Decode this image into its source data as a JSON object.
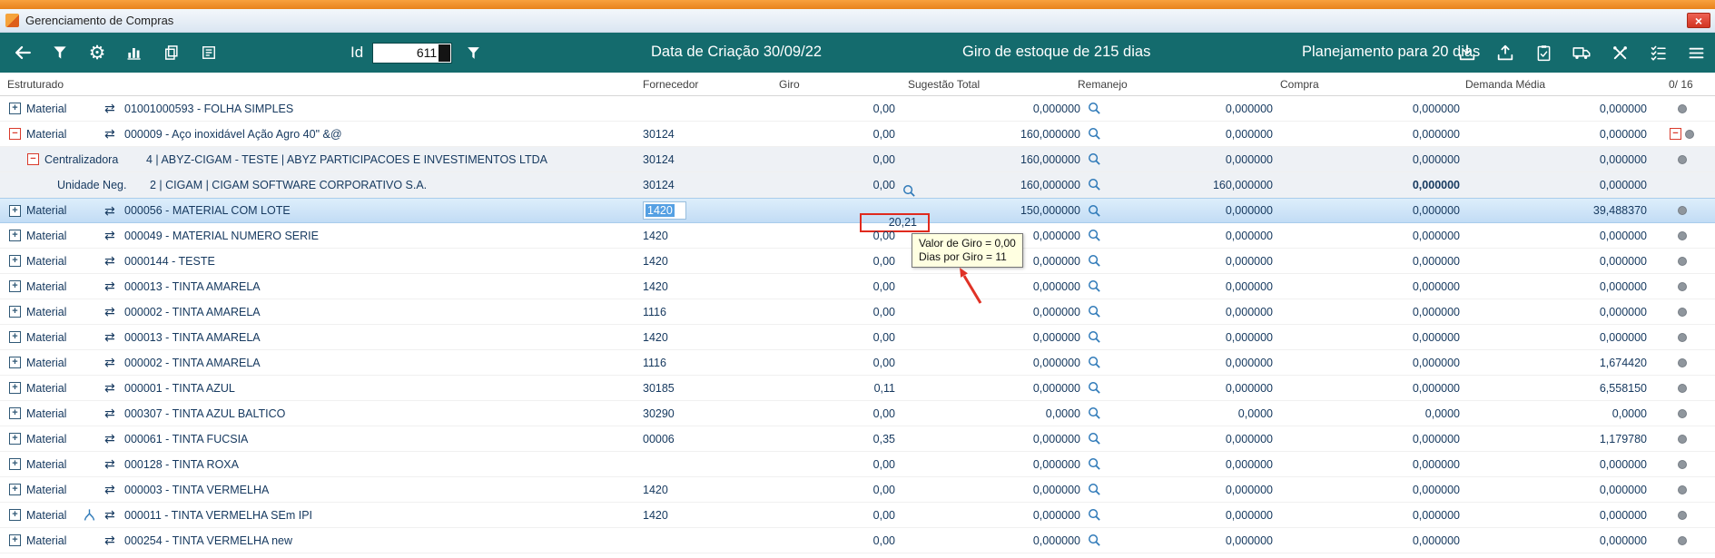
{
  "window": {
    "title": "Gerenciamento de Compras",
    "close_glyph": "×"
  },
  "toolbar": {
    "id_label": "Id",
    "id_value": "611",
    "data_criacao": "Data de Criação 30/09/22",
    "giro_estoque": "Giro de estoque de  215 dias",
    "planejamento": "Planejamento para 20 dias",
    "left_icons": [
      "back-arrow",
      "filter-funnel",
      "settings-gear",
      "bar-chart",
      "copy-pages",
      "notes-card"
    ],
    "right_icons": [
      "import-tray",
      "export-tray",
      "clipboard-check",
      "delivery-truck",
      "tools-cross",
      "task-checklist",
      "hamburger-menu"
    ]
  },
  "colors": {
    "toolbar_teal": "#146b6d",
    "top_strip_orange": "#ee8a24",
    "selected_row_blue": "#c6def5",
    "annotation_red": "#e02a1e",
    "tooltip_yellow": "#ffffe1",
    "row_text_navy": "#173a60"
  },
  "columns": [
    "Estruturado",
    "Fornecedor",
    "Giro",
    "Sugestão Total",
    "Remanejo",
    "Compra",
    "Demanda Média",
    "0/ 16"
  ],
  "tooltip": {
    "line1": "Valor de Giro = 0,00",
    "line2": "Dias por Giro = 11"
  },
  "rows": [
    {
      "level": 0,
      "expand": "plus",
      "type": "Material",
      "swap": true,
      "label": "01001000593 -  FOLHA SIMPLES",
      "fornecedor": "",
      "giro": "0,00",
      "sugestao": "0,000000",
      "remanejo": "0,000000",
      "compra": "0,000000",
      "demanda": "0,000000",
      "dot": true,
      "bg": "white"
    },
    {
      "level": 0,
      "expand": "minus",
      "type": "Material",
      "swap": true,
      "label": "000009 - Aço inoxidável Ação Agro 40\" &@",
      "fornecedor": "30124",
      "giro": "0,00",
      "sugestao": "160,000000",
      "remanejo": "0,000000",
      "compra": "0,000000",
      "demanda": "0,000000",
      "dot": true,
      "red_minus_right": true,
      "bg": "white"
    },
    {
      "level": 1,
      "expand": "minus",
      "type": "Centralizadora",
      "swap": false,
      "label": "4  | ABYZ-CIGAM - TESTE | ABYZ PARTICIPACOES E INVESTIMENTOS LTDA",
      "fornecedor": "30124",
      "giro": "0,00",
      "sugestao": "160,000000",
      "remanejo": "0,000000",
      "compra": "0,000000",
      "demanda": "0,000000",
      "dot": true,
      "bg": "shade"
    },
    {
      "level": 2,
      "expand": "none",
      "type": "Unidade Neg.",
      "swap": false,
      "label": "2 | CIGAM | CIGAM SOFTWARE CORPORATIVO S.A.",
      "fornecedor": "30124",
      "giro": "0,00",
      "giro_mag": true,
      "sugestao": "160,000000",
      "remanejo": "160,000000",
      "compra": "0,000000",
      "compra_bold": true,
      "demanda": "0,000000",
      "dot": false,
      "bg": "shade"
    },
    {
      "level": 0,
      "expand": "plus",
      "type": "Material",
      "swap": true,
      "label": "000056 - MATERIAL  COM LOTE",
      "fornecedor": "1420",
      "forn_sel": true,
      "giro": "20,21",
      "giro_box": true,
      "sugestao": "150,000000",
      "remanejo": "0,000000",
      "compra": "0,000000",
      "demanda": "39,488370",
      "dot": true,
      "bg": "selected"
    },
    {
      "level": 0,
      "expand": "plus",
      "type": "Material",
      "swap": true,
      "label": "000049 - MATERIAL NUMERO SERIE",
      "fornecedor": "1420",
      "giro": "0,00",
      "sugestao": "0,000000",
      "remanejo": "0,000000",
      "compra": "0,000000",
      "demanda": "0,000000",
      "dot": true,
      "bg": "white"
    },
    {
      "level": 0,
      "expand": "plus",
      "type": "Material",
      "swap": true,
      "label": "0000144 - TESTE",
      "fornecedor": "1420",
      "giro": "0,00",
      "sugestao": "0,000000",
      "remanejo": "0,000000",
      "compra": "0,000000",
      "demanda": "0,000000",
      "dot": true,
      "bg": "white"
    },
    {
      "level": 0,
      "expand": "plus",
      "type": "Material",
      "swap": true,
      "label": "000013 - TINTA AMARELA",
      "fornecedor": "1420",
      "giro": "0,00",
      "sugestao": "0,000000",
      "remanejo": "0,000000",
      "compra": "0,000000",
      "demanda": "0,000000",
      "dot": true,
      "bg": "white"
    },
    {
      "level": 0,
      "expand": "plus",
      "type": "Material",
      "swap": true,
      "label": "000002 - TINTA AMARELA",
      "fornecedor": "1116",
      "giro": "0,00",
      "sugestao": "0,000000",
      "remanejo": "0,000000",
      "compra": "0,000000",
      "demanda": "0,000000",
      "dot": true,
      "bg": "white"
    },
    {
      "level": 0,
      "expand": "plus",
      "type": "Material",
      "swap": true,
      "label": "000013 - TINTA AMARELA",
      "fornecedor": "1420",
      "giro": "0,00",
      "sugestao": "0,000000",
      "remanejo": "0,000000",
      "compra": "0,000000",
      "demanda": "0,000000",
      "dot": true,
      "bg": "white"
    },
    {
      "level": 0,
      "expand": "plus",
      "type": "Material",
      "swap": true,
      "label": "000002 - TINTA AMARELA",
      "fornecedor": "1116",
      "giro": "0,00",
      "sugestao": "0,000000",
      "remanejo": "0,000000",
      "compra": "0,000000",
      "demanda": "1,674420",
      "dot": true,
      "bg": "white"
    },
    {
      "level": 0,
      "expand": "plus",
      "type": "Material",
      "swap": true,
      "label": "000001 - TINTA AZUL",
      "fornecedor": "30185",
      "giro": "0,11",
      "sugestao": "0,000000",
      "remanejo": "0,000000",
      "compra": "0,000000",
      "demanda": "6,558150",
      "dot": true,
      "bg": "white"
    },
    {
      "level": 0,
      "expand": "plus",
      "type": "Material",
      "swap": true,
      "label": "000307 - TINTA AZUL BALTICO",
      "fornecedor": "30290",
      "giro": "0,00",
      "sugestao": "0,0000",
      "remanejo": "0,0000",
      "compra": "0,0000",
      "demanda": "0,0000",
      "dot": true,
      "bg": "white"
    },
    {
      "level": 0,
      "expand": "plus",
      "type": "Material",
      "swap": true,
      "label": "000061 - TINTA FUCSIA",
      "fornecedor": "00006",
      "giro": "0,35",
      "sugestao": "0,000000",
      "remanejo": "0,000000",
      "compra": "0,000000",
      "demanda": "1,179780",
      "dot": true,
      "bg": "white"
    },
    {
      "level": 0,
      "expand": "plus",
      "type": "Material",
      "swap": true,
      "label": "000128 - TINTA ROXA",
      "fornecedor": "",
      "giro": "0,00",
      "sugestao": "0,000000",
      "remanejo": "0,000000",
      "compra": "0,000000",
      "demanda": "0,000000",
      "dot": true,
      "bg": "white"
    },
    {
      "level": 0,
      "expand": "plus",
      "type": "Material",
      "swap": true,
      "label": "000003 - TINTA VERMELHA",
      "fornecedor": "1420",
      "giro": "0,00",
      "sugestao": "0,000000",
      "remanejo": "0,000000",
      "compra": "0,000000",
      "demanda": "0,000000",
      "dot": true,
      "bg": "white"
    },
    {
      "level": 0,
      "expand": "plus",
      "type": "Material",
      "swap": true,
      "branch": true,
      "label": "000011 - TINTA VERMELHA SEm IPI",
      "fornecedor": "1420",
      "giro": "0,00",
      "sugestao": "0,000000",
      "remanejo": "0,000000",
      "compra": "0,000000",
      "demanda": "0,000000",
      "dot": true,
      "bg": "white"
    },
    {
      "level": 0,
      "expand": "plus",
      "type": "Material",
      "swap": true,
      "label": "000254 - TINTA VERMELHA new",
      "fornecedor": "",
      "giro": "0,00",
      "sugestao": "0,000000",
      "remanejo": "0,000000",
      "compra": "0,000000",
      "demanda": "0,000000",
      "dot": true,
      "bg": "white"
    }
  ]
}
